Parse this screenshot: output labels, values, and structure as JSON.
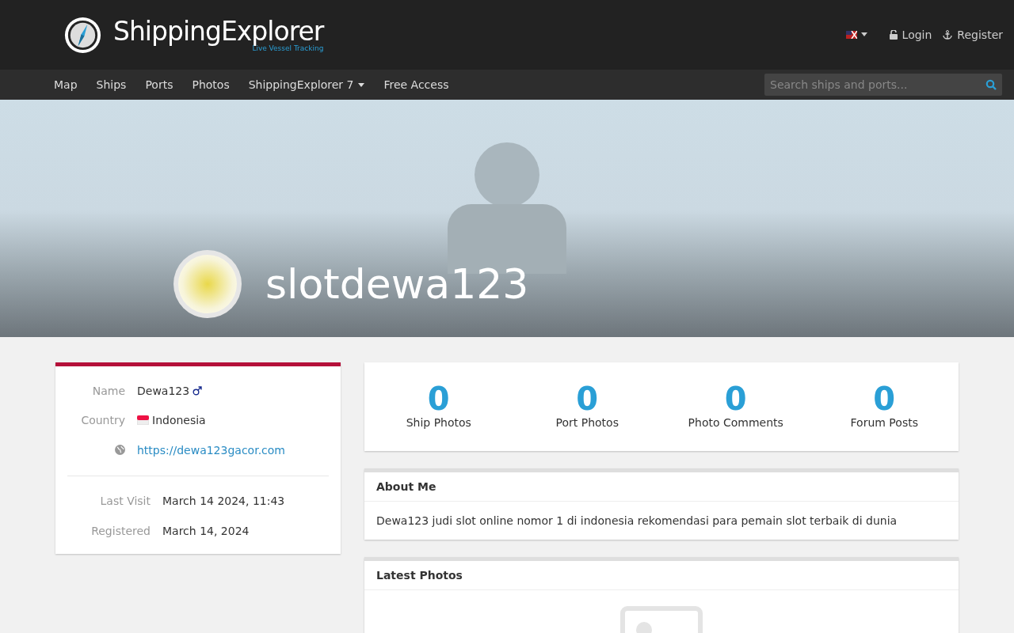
{
  "brand": {
    "name": "ShippingExplorer",
    "tagline": "Live Vessel Tracking"
  },
  "top_links": [
    "Login",
    "Register"
  ],
  "nav": [
    {
      "label": "Map",
      "dropdown": false
    },
    {
      "label": "Ships",
      "dropdown": false
    },
    {
      "label": "Ports",
      "dropdown": false
    },
    {
      "label": "Photos",
      "dropdown": false
    },
    {
      "label": "ShippingExplorer 7",
      "dropdown": true
    },
    {
      "label": "Free Access",
      "dropdown": false
    }
  ],
  "search": {
    "placeholder": "Search ships and ports..."
  },
  "profile": {
    "username": "slotdewa123"
  },
  "details": [
    {
      "label": "Name",
      "value": "Dewa123",
      "kind": "name"
    },
    {
      "label": "Country",
      "value": "Indonesia",
      "kind": "country"
    },
    {
      "value": "https://dewa123gacor.com",
      "kind": "website"
    }
  ],
  "visits": [
    {
      "label": "Last Visit",
      "value": "March 14 2024, 11:43"
    },
    {
      "label": "Registered",
      "value": "March 14, 2024"
    }
  ],
  "stats": [
    {
      "value": "0",
      "label": "Ship Photos"
    },
    {
      "value": "0",
      "label": "Port Photos"
    },
    {
      "value": "0",
      "label": "Photo Comments"
    },
    {
      "value": "0",
      "label": "Forum Posts"
    }
  ],
  "about": {
    "title": "About Me",
    "text": "Dewa123 judi slot online nomor 1 di indonesia rekomendasi para pemain slot terbaik di dunia"
  },
  "latest_photos": {
    "title": "Latest Photos"
  }
}
